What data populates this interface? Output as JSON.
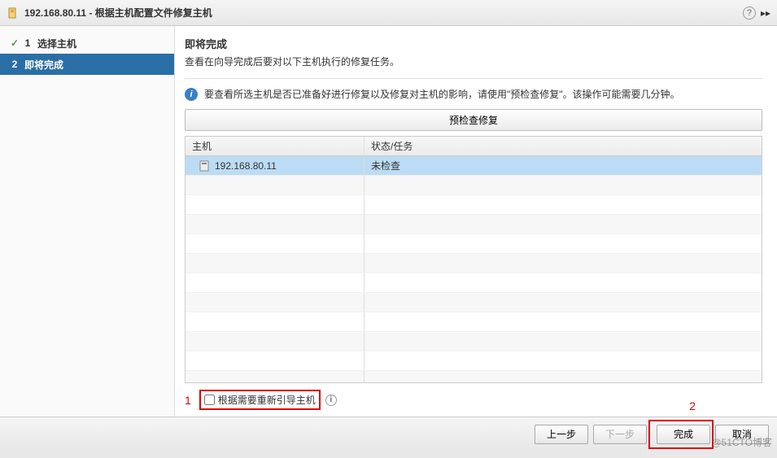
{
  "title_bar": {
    "host_ip": "192.168.80.11",
    "separator": " - ",
    "title": "根据主机配置文件修复主机",
    "help_tooltip": "?"
  },
  "sidebar": {
    "items": [
      {
        "num": "1",
        "label": "选择主机",
        "completed": true
      },
      {
        "num": "2",
        "label": "即将完成",
        "active": true
      }
    ]
  },
  "main": {
    "heading": "即将完成",
    "description": "查看在向导完成后要对以下主机执行的修复任务。",
    "info_text": "要查看所选主机是否已准备好进行修复以及修复对主机的影响，请使用\"预检查修复\"。该操作可能需要几分钟。",
    "precheck_button": "预检查修复",
    "table": {
      "headers": {
        "host": "主机",
        "status": "状态/任务"
      },
      "rows": [
        {
          "host": "192.168.80.11",
          "status": "未检查",
          "selected": true
        }
      ],
      "empty_row_count": 11
    },
    "checkbox_label": "根据需要重新引导主机",
    "annotation_1": "1",
    "annotation_2": "2"
  },
  "footer": {
    "back": "上一步",
    "next": "下一步",
    "finish": "完成",
    "cancel": "取消"
  },
  "watermark": "@51CTO博客"
}
